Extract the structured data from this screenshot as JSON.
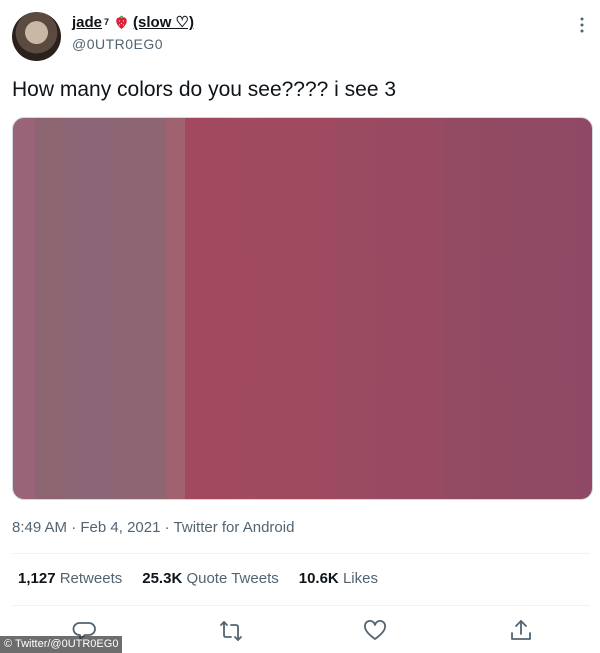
{
  "author": {
    "name": "jade",
    "superscript": "7",
    "status": "(slow ♡)",
    "handle": "@0UTR0EG0"
  },
  "tweet": {
    "text": "How many colors do you see???? i see 3",
    "time": "8:49 AM",
    "date": "Feb 4, 2021",
    "source": "Twitter for Android",
    "meta_separator": "·"
  },
  "stats": {
    "retweets": {
      "count": "1,127",
      "label": "Retweets"
    },
    "quote_tweets": {
      "count": "25.3K",
      "label": "Quote Tweets"
    },
    "likes": {
      "count": "10.6K",
      "label": "Likes"
    }
  },
  "icons": {
    "more": "more-dots-icon",
    "reply": "reply-icon",
    "retweet": "retweet-icon",
    "like": "heart-icon",
    "share": "share-icon",
    "emoji": "strawberry-icon"
  },
  "colors": {
    "text": "#0f1419",
    "secondary": "#536471",
    "divider": "#eff3f4"
  },
  "credit": "© Twitter/@0UTR0EG0"
}
